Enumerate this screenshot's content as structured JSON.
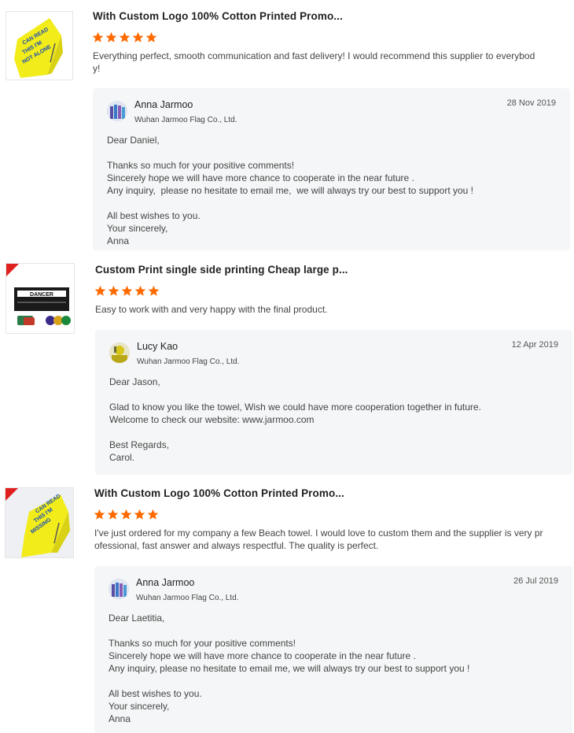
{
  "accent_color": "#ff6a00",
  "reviews": [
    {
      "product_title": "With Custom Logo 100% Cotton Printed Promo...",
      "rating": 5,
      "comment_lines": [
        "Everything perfect, smooth communication and fast delivery! I would recommend this supplier to everybod",
        "y!"
      ],
      "reply": {
        "name": "Anna Jarmoo",
        "company": "Wuhan Jarmoo Flag Co., Ltd.",
        "date": "28 Nov 2019",
        "lines": [
          "Dear Daniel,",
          "",
          "Thanks so much for your positive comments!",
          "Sincerely hope we will have more chance to cooperate in the near future .",
          "Any inquiry,  please no hesitate to email me,  we will always try our best to support you !",
          "",
          "All best wishes to you.",
          "Your sincerely,",
          "Anna"
        ]
      }
    },
    {
      "product_title": "Custom Print single side printing Cheap large p...",
      "rating": 5,
      "thumb_text": "DANCER",
      "comment_lines": [
        "Easy to work with and very happy with the final product."
      ],
      "reply": {
        "name": "Lucy Kao",
        "company": "Wuhan Jarmoo Flag Co., Ltd.",
        "date": "12 Apr 2019",
        "lines": [
          "Dear Jason,",
          "",
          "Glad to know you like the towel, Wish we could have more cooperation together in future.",
          "Welcome to check our website: www.jarmoo.com",
          "",
          "Best Regards,",
          "Carol."
        ]
      }
    },
    {
      "product_title": "With Custom Logo 100% Cotton Printed Promo...",
      "rating": 5,
      "comment_lines": [
        "I've just ordered for my company a few Beach towel. I would love to custom them and the supplier is very pr",
        "ofessional, fast answer and always respectful. The quality is perfect."
      ],
      "reply": {
        "name": "Anna Jarmoo",
        "company": "Wuhan Jarmoo Flag Co., Ltd.",
        "date": "26 Jul 2019",
        "lines": [
          "Dear Laetitia,",
          "",
          "Thanks so much for your positive comments!",
          "Sincerely hope we will have more chance to cooperate in the near future .",
          "Any inquiry, please no hesitate to email me, we will always try our best to support you !",
          "",
          "All best wishes to you.",
          "Your sincerely,",
          "Anna"
        ]
      }
    }
  ]
}
